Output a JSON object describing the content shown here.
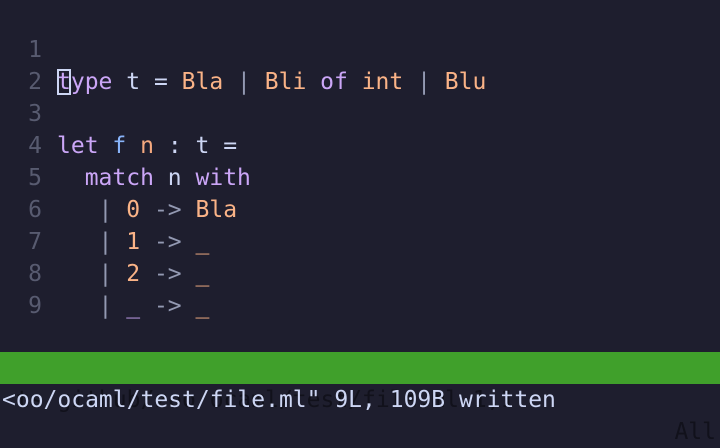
{
  "editor": {
    "lines": [
      {
        "num": "1",
        "tokens": [
          "t",
          "ype",
          " t = ",
          "Bla",
          " | ",
          "Bli",
          " of ",
          "int",
          " | ",
          "Blu"
        ]
      },
      {
        "num": "2"
      },
      {
        "num": "3",
        "tokens": [
          "let",
          " ",
          "f",
          " ",
          "n",
          " : t ="
        ]
      },
      {
        "num": "4",
        "tokens": [
          "  ",
          "match",
          " n ",
          "with"
        ]
      },
      {
        "num": "5",
        "tokens": [
          "   | ",
          "0",
          " -> ",
          "Bla"
        ]
      },
      {
        "num": "6",
        "tokens": [
          "   | ",
          "1",
          " -> ",
          "_"
        ]
      },
      {
        "num": "7",
        "tokens": [
          "   | ",
          "2",
          " -> ",
          "_"
        ]
      },
      {
        "num": "8",
        "tokens": [
          "   | ",
          "_",
          " -> ",
          "_"
        ]
      },
      {
        "num": "9"
      }
    ]
  },
  "statusline": {
    "path": "<ts/github/zoo/ocaml/test/file.ml 1,1",
    "position": "All"
  },
  "cmdline": {
    "message": "<oo/ocaml/test/file.ml\" 9L, 109B written"
  },
  "colors": {
    "background": "#1e1e2e",
    "statusline": "#40a02b",
    "keyword": "#cba6f7",
    "constructor": "#fab387",
    "function": "#89b4fa",
    "line_number": "#585b70"
  }
}
